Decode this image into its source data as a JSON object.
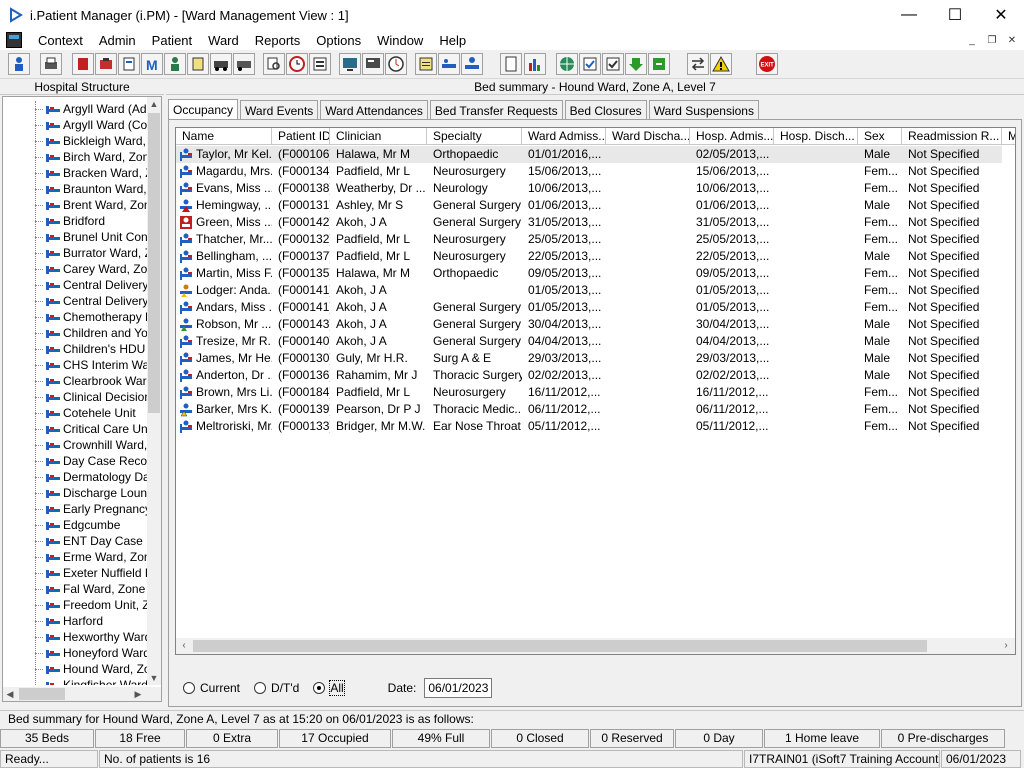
{
  "window": {
    "title": "i.Patient Manager (i.PM) - [Ward Management View : 1]",
    "minimize": "—",
    "maximize": "☐",
    "close": "✕"
  },
  "menu": {
    "items": [
      "Context",
      "Admin",
      "Patient",
      "Ward",
      "Reports",
      "Options",
      "Window",
      "Help"
    ],
    "mdi_minimize": "_",
    "mdi_restore": "❐",
    "mdi_close": "✕"
  },
  "left_panel": {
    "title": "Hospital Structure",
    "items": [
      "Argyll Ward (Adul",
      "Argyll Ward (Cots",
      "Bickleigh Ward, Z",
      "Birch Ward, Zone",
      "Bracken Ward, Z",
      "Braunton Ward, Z",
      "Brent Ward, Zone",
      "Bridford",
      "Brunel Unit Contin",
      "Burrator Ward, Zo",
      "Carey Ward, Zon",
      "Central Delivery S",
      "Central Delivery S",
      "Chemotherapy D",
      "Children and You",
      "Children's HDU (N",
      "CHS Interim Ward",
      "Clearbrook Ward",
      "Clinical Decision",
      "Cotehele Unit",
      "Critical Care Unit",
      "Crownhill Ward, Z",
      "Day Case Recov",
      "Dermatology Day",
      "Discharge Loung",
      "Early Pregnancy",
      "Edgcumbe",
      "ENT Day Case U",
      "Erme Ward, Zone",
      "Exeter Nuffield H",
      "Fal Ward, Zone E",
      "Freedom Unit, Zo",
      "Harford",
      "Hexworthy Ward,",
      "Honeyford Ward,",
      "Hound Ward, Zo",
      "Kingfisher Ward"
    ]
  },
  "right_panel": {
    "title": "Bed summary - Hound Ward, Zone A, Level 7",
    "tabs": [
      "Occupancy",
      "Ward Events",
      "Ward Attendances",
      "Bed Transfer Requests",
      "Bed Closures",
      "Ward Suspensions"
    ],
    "active_tab": 0
  },
  "grid": {
    "columns": [
      "Name",
      "Patient ID",
      "Clinician",
      "Specialty",
      "Ward Admiss...",
      "Ward Discha...",
      "Hosp. Admis...",
      "Hosp. Disch...",
      "Sex",
      "Readmission R...",
      "M"
    ],
    "rows": [
      {
        "icon": "patient-bed-icon",
        "name": "Taylor, Mr Kel...",
        "id": "(F000106)",
        "clinician": "Halawa, Mr M",
        "specialty": "Orthopaedic",
        "ward_adm": "01/01/2016,...",
        "ward_dis": "",
        "hosp_adm": "02/05/2013,...",
        "hosp_dis": "",
        "sex": "Male",
        "readm": "Not Specified"
      },
      {
        "icon": "patient-bed-icon",
        "name": "Magardu, Mrs...",
        "id": "(F000134)",
        "clinician": "Padfield, Mr L",
        "specialty": "Neurosurgery",
        "ward_adm": "15/06/2013,...",
        "ward_dis": "",
        "hosp_adm": "15/06/2013,...",
        "hosp_dis": "",
        "sex": "Fem...",
        "readm": "Not Specified"
      },
      {
        "icon": "patient-bed-icon",
        "name": "Evans, Miss ...",
        "id": "(F000138)",
        "clinician": "Weatherby, Dr ...",
        "specialty": "Neurology",
        "ward_adm": "10/06/2013,...",
        "ward_dis": "",
        "hosp_adm": "10/06/2013,...",
        "hosp_dis": "",
        "sex": "Fem...",
        "readm": "Not Specified"
      },
      {
        "icon": "patient-alert-red-icon",
        "name": "Hemingway, ...",
        "id": "(F000131)",
        "clinician": "Ashley, Mr S",
        "specialty": "General Surgery",
        "ward_adm": "01/06/2013,...",
        "ward_dis": "",
        "hosp_adm": "01/06/2013,...",
        "hosp_dis": "",
        "sex": "Male",
        "readm": "Not Specified"
      },
      {
        "icon": "patient-red-box-icon",
        "name": "Green, Miss ...",
        "id": "(F000142)",
        "clinician": "Akoh, J A",
        "specialty": "General Surgery",
        "ward_adm": "31/05/2013,...",
        "ward_dis": "",
        "hosp_adm": "31/05/2013,...",
        "hosp_dis": "",
        "sex": "Fem...",
        "readm": "Not Specified"
      },
      {
        "icon": "patient-bed-icon",
        "name": "Thatcher, Mr...",
        "id": "(F000132)",
        "clinician": "Padfield, Mr L",
        "specialty": "Neurosurgery",
        "ward_adm": "25/05/2013,...",
        "ward_dis": "",
        "hosp_adm": "25/05/2013,...",
        "hosp_dis": "",
        "sex": "Fem...",
        "readm": "Not Specified"
      },
      {
        "icon": "patient-bed-icon",
        "name": "Bellingham, ...",
        "id": "(F000137)",
        "clinician": "Padfield, Mr L",
        "specialty": "Neurosurgery",
        "ward_adm": "22/05/2013,...",
        "ward_dis": "",
        "hosp_adm": "22/05/2013,...",
        "hosp_dis": "",
        "sex": "Male",
        "readm": "Not Specified"
      },
      {
        "icon": "patient-bed-icon",
        "name": "Martin, Miss F...",
        "id": "(F000135)",
        "clinician": "Halawa, Mr M",
        "specialty": "Orthopaedic",
        "ward_adm": "09/05/2013,...",
        "ward_dis": "",
        "hosp_adm": "09/05/2013,...",
        "hosp_dis": "",
        "sex": "Fem...",
        "readm": "Not Specified"
      },
      {
        "icon": "lodger-icon",
        "name": "Lodger: Anda...",
        "id": "(F000141)",
        "clinician": "Akoh, J A",
        "specialty": "",
        "ward_adm": "01/05/2013,...",
        "ward_dis": "",
        "hosp_adm": "01/05/2013,...",
        "hosp_dis": "",
        "sex": "Fem...",
        "readm": "Not Specified"
      },
      {
        "icon": "patient-bed-icon",
        "name": "Andars, Miss ...",
        "id": "(F000141)",
        "clinician": "Akoh, J A",
        "specialty": "General Surgery",
        "ward_adm": "01/05/2013,...",
        "ward_dis": "",
        "hosp_adm": "01/05/2013,...",
        "hosp_dis": "",
        "sex": "Fem...",
        "readm": "Not Specified"
      },
      {
        "icon": "patient-alert-green-icon",
        "name": "Robson, Mr ...",
        "id": "(F000143)",
        "clinician": "Akoh, J A",
        "specialty": "General Surgery",
        "ward_adm": "30/04/2013,...",
        "ward_dis": "",
        "hosp_adm": "30/04/2013,...",
        "hosp_dis": "",
        "sex": "Male",
        "readm": "Not Specified"
      },
      {
        "icon": "patient-bed-icon",
        "name": "Tresize, Mr R...",
        "id": "(F000140)",
        "clinician": "Akoh, J A",
        "specialty": "General Surgery",
        "ward_adm": "04/04/2013,...",
        "ward_dis": "",
        "hosp_adm": "04/04/2013,...",
        "hosp_dis": "",
        "sex": "Male",
        "readm": "Not Specified"
      },
      {
        "icon": "patient-bed-icon",
        "name": "James, Mr He...",
        "id": "(F000130)",
        "clinician": "Guly, Mr H.R.",
        "specialty": "Surg A & E",
        "ward_adm": "29/03/2013,...",
        "ward_dis": "",
        "hosp_adm": "29/03/2013,...",
        "hosp_dis": "",
        "sex": "Male",
        "readm": "Not Specified"
      },
      {
        "icon": "patient-bed-icon",
        "name": "Anderton, Dr ...",
        "id": "(F000136)",
        "clinician": "Rahamim, Mr J",
        "specialty": "Thoracic Surgery",
        "ward_adm": "02/02/2013,...",
        "ward_dis": "",
        "hosp_adm": "02/02/2013,...",
        "hosp_dis": "",
        "sex": "Male",
        "readm": "Not Specified"
      },
      {
        "icon": "patient-bed-icon",
        "name": "Brown, Mrs Li...",
        "id": "(F000184)",
        "clinician": "Padfield, Mr L",
        "specialty": "Neurosurgery",
        "ward_adm": "16/11/2012,...",
        "ward_dis": "",
        "hosp_adm": "16/11/2012,...",
        "hosp_dis": "",
        "sex": "Fem...",
        "readm": "Not Specified"
      },
      {
        "icon": "patient-alert-yellow-icon",
        "name": "Barker, Mrs K...",
        "id": "(F000139)",
        "clinician": "Pearson, Dr P J",
        "specialty": "Thoracic Medic...",
        "ward_adm": "06/11/2012,...",
        "ward_dis": "",
        "hosp_adm": "06/11/2012,...",
        "hosp_dis": "",
        "sex": "Fem...",
        "readm": "Not Specified"
      },
      {
        "icon": "patient-bed-icon",
        "name": "Meltroriski, Mr...",
        "id": "(F000133)",
        "clinician": "Bridger, Mr M.W.",
        "specialty": "Ear Nose Throat",
        "ward_adm": "05/11/2012,...",
        "ward_dis": "",
        "hosp_adm": "05/11/2012,...",
        "hosp_dis": "",
        "sex": "Fem...",
        "readm": "Not Specified"
      }
    ]
  },
  "filters": {
    "current_label": "Current",
    "dtd_label": "D/T'd",
    "all_label": "All",
    "selected": "All",
    "date_label": "Date:",
    "date_value": "06/01/2023"
  },
  "summary_line": "Bed summary for Hound Ward, Zone A, Level 7 as at 15:20 on 06/01/2023 is as follows:",
  "stats": [
    "35 Beds",
    "18 Free",
    "0 Extra",
    "17 Occupied",
    "49% Full",
    "0 Closed",
    "0 Reserved",
    "0 Day",
    "1 Home leave",
    "0 Pre-discharges"
  ],
  "status": {
    "ready": "Ready...",
    "patients": "No. of patients is 16",
    "account": "I7TRAIN01 (iSoft7 Training Account)",
    "date": "06/01/2023"
  },
  "colors": {
    "accent": "#1f5fbf",
    "exit_red": "#d01010"
  }
}
